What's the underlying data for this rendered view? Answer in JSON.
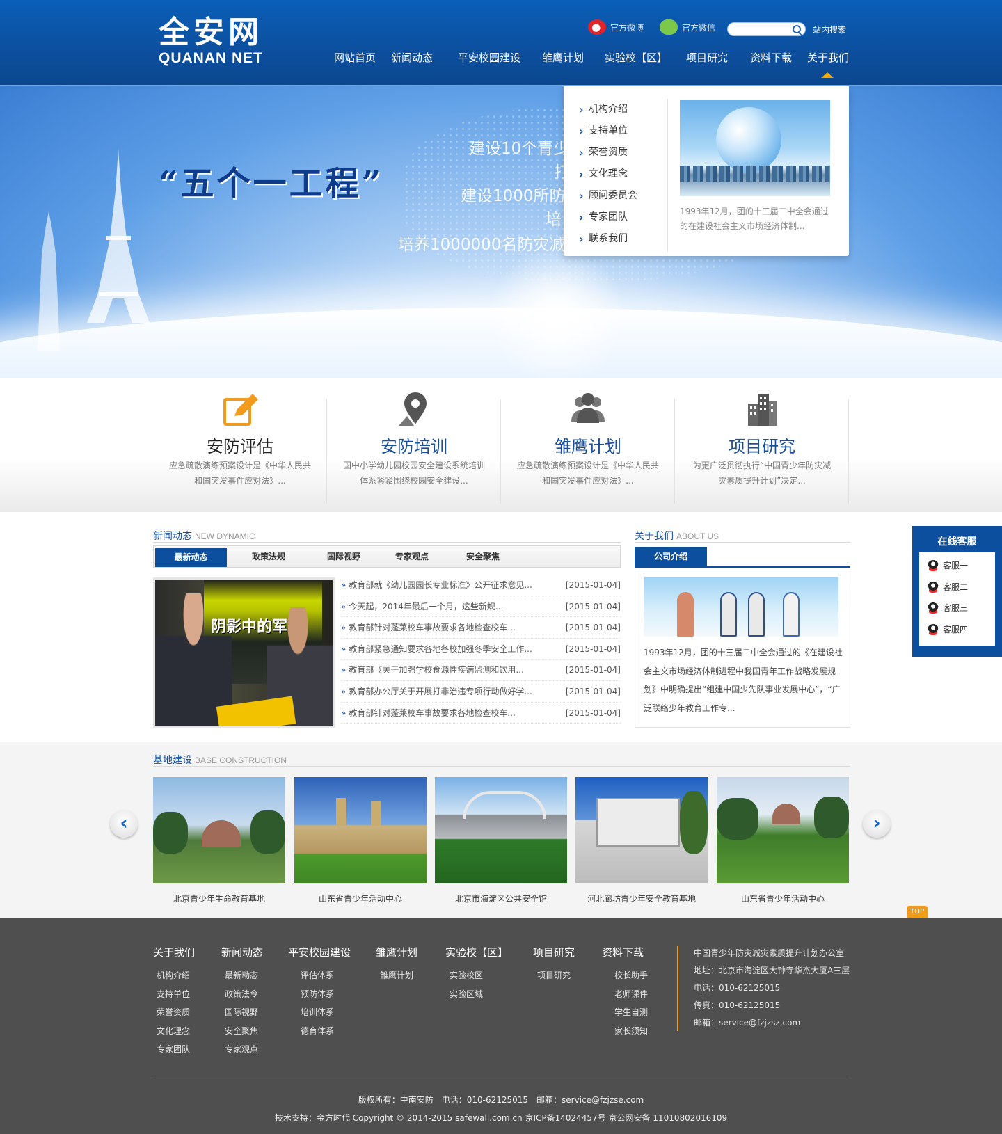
{
  "header": {
    "logo_cn": "全安网",
    "logo_en": "QUANAN NET",
    "weibo_label": "官方微博",
    "wechat_label": "官方微信",
    "search_placeholder": "",
    "search_label": "站内搜索",
    "nav": [
      "网站首页",
      "新闻动态",
      "平安校园建设",
      "雏鹰计划",
      "实验校【区】",
      "项目研究",
      "资料下载",
      "关于我们"
    ]
  },
  "banner": {
    "slogan": "“五个一工程”",
    "lines": [
      "建设10个青少",
      "打",
      "建设1000所防",
      "培",
      "培养1000000名防灾减"
    ]
  },
  "dropdown": {
    "items": [
      "机构介绍",
      "支持单位",
      "荣誉资质",
      "文化理念",
      "顾问委员会",
      "专家团队",
      "联系我们"
    ],
    "text": "1993年12月，团的十三届二中全会通过的在建设社会主义市场经济体制..."
  },
  "services": [
    {
      "title": "安防评估",
      "desc": "应急疏散演练预案设计是《中华人民共和国突发事件应对法》...",
      "icon": "pencil-edit-icon"
    },
    {
      "title": "安防培训",
      "desc": "国中小学幼儿园校园安全建设系统培训体系紧紧围绕校园安全建设...",
      "icon": "map-pin-icon"
    },
    {
      "title": "雏鹰计划",
      "desc": "应急疏散演练预案设计是《中华人民共和国突发事件应对法》...",
      "icon": "group-icon"
    },
    {
      "title": "项目研究",
      "desc": "为更广泛贯彻执行“中国青少年防灾减灾素质提升计划”决定...",
      "icon": "buildings-icon"
    }
  ],
  "news": {
    "title_cn": "新闻动态",
    "title_en": "NEW DYNAMIC",
    "tabs": [
      "最新动态",
      "政策法规",
      "国际视野",
      "专家观点",
      "安全聚焦"
    ],
    "photo_text": "阴影中的军队",
    "items": [
      {
        "title": "教育部就《幼儿园园长专业标准》公开征求意见...",
        "date": "[2015-01-04]"
      },
      {
        "title": "今天起，2014年最后一个月，这些新规...",
        "date": "[2015-01-04]"
      },
      {
        "title": "教育部针对蓬莱校车事故要求各地检查校车...",
        "date": "[2015-01-04]"
      },
      {
        "title": "教育部紧急通知要求各地各校加强冬季安全工作...",
        "date": "[2015-01-04]"
      },
      {
        "title": "教育部《关于加强学校食源性疾病监测和饮用...",
        "date": "[2015-01-04]"
      },
      {
        "title": "教育部办公厅关于开展打非治违专项行动做好学...",
        "date": "[2015-01-04]"
      },
      {
        "title": "教育部针对蓬莱校车事故要求各地检查校车...",
        "date": "[2015-01-04]"
      }
    ]
  },
  "about": {
    "title_cn": "关于我们",
    "title_en": "ABOUT US",
    "tab": "公司介绍",
    "text": "1993年12月，团的十三届二中全会通过的《在建设社会主义市场经济体制进程中我国青年工作战略发展规划》中明确提出“组建中国少先队事业发展中心”，“广泛联络少年教育工作专..."
  },
  "kefu": {
    "title": "在线客服",
    "items": [
      "客服一",
      "客服二",
      "客服三",
      "客服四"
    ]
  },
  "base": {
    "title_cn": "基地建设",
    "title_en": "BASE CONSTRUCTION",
    "items": [
      "北京青少年生命教育基地",
      "山东省青少年活动中心",
      "北京市海淀区公共安全馆",
      "河北廊坊青少年安全教育基地",
      "山东省青少年活动中心"
    ],
    "prev_glyph": "‹",
    "next_glyph": "›",
    "top_label": "TOP"
  },
  "footer": {
    "columns": [
      {
        "head": "关于我们",
        "links": [
          "机构介绍",
          "支持单位",
          "荣誉资质",
          "文化理念",
          "专家团队"
        ]
      },
      {
        "head": "新闻动态",
        "links": [
          "最新动态",
          "政策法令",
          "国际视野",
          "安全聚焦",
          "专家观点"
        ]
      },
      {
        "head": "平安校园建设",
        "links": [
          "评估体系",
          "预防体系",
          "培训体系",
          "德育体系"
        ]
      },
      {
        "head": "雏鹰计划",
        "links": [
          "雏鹰计划"
        ]
      },
      {
        "head": "实验校【区】",
        "links": [
          "实验校区",
          "实验区域"
        ]
      },
      {
        "head": "项目研究",
        "links": [
          "项目研究"
        ]
      },
      {
        "head": "资料下载",
        "links": [
          "校长助手",
          "老师课件",
          "学生自测",
          "家长须知"
        ]
      }
    ],
    "contact": [
      "中国青少年防灾减灾素质提升计划办公室",
      "地址：北京市海淀区大钟寺华杰大厦A三层",
      "电话：010-62125015",
      "传真：010-62125015",
      "邮箱：service@fzjzsz.com"
    ],
    "copyright1": "版权所有：中南安防　电话：010-62125015　邮箱：service@fzjzse.com",
    "copyright2": "技术支持：金方时代 Copyright © 2014-2015 safewall.com.cn 京ICP备14024457号 京公网安备 11010802016109"
  }
}
